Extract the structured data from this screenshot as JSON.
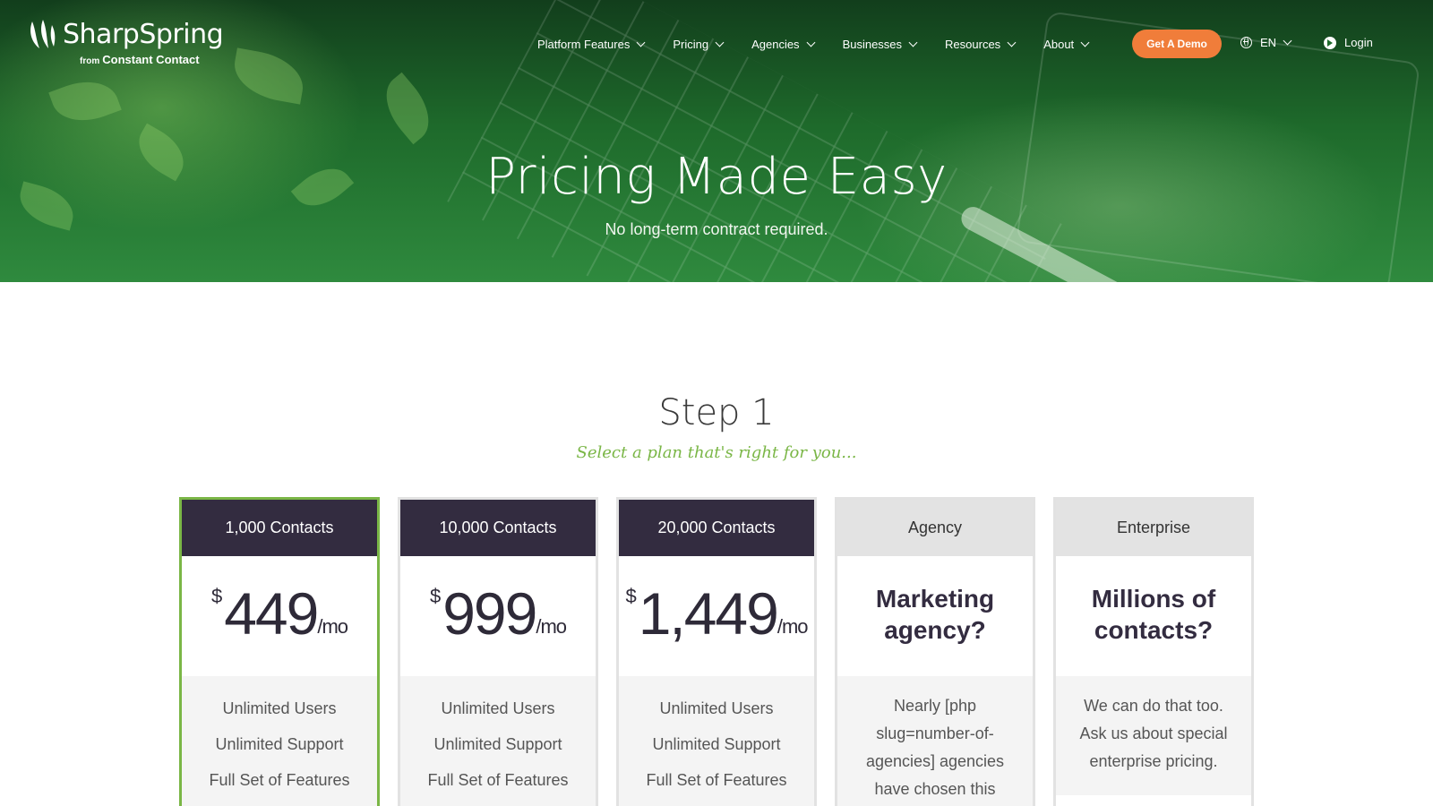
{
  "brand": {
    "name": "SharpSpring",
    "sub_from": "from",
    "sub_company": "Constant Contact"
  },
  "nav": {
    "items": [
      {
        "label": "Platform Features"
      },
      {
        "label": "Pricing"
      },
      {
        "label": "Agencies"
      },
      {
        "label": "Businesses"
      },
      {
        "label": "Resources"
      },
      {
        "label": "About"
      }
    ],
    "demo_label": "Get A Demo",
    "lang_label": "EN",
    "login_label": "Login"
  },
  "hero": {
    "title": "Pricing Made Easy",
    "subtitle": "No long-term contract required."
  },
  "step": {
    "title": "Step 1",
    "subtitle": "Select a plan that's right for you..."
  },
  "plans": [
    {
      "name": "1,000 Contacts",
      "currency": "$",
      "amount": "449",
      "period": "/mo",
      "features": [
        "Unlimited Users",
        "Unlimited Support",
        "Full Set of Features"
      ]
    },
    {
      "name": "10,000 Contacts",
      "currency": "$",
      "amount": "999",
      "period": "/mo",
      "features": [
        "Unlimited Users",
        "Unlimited Support",
        "Full Set of Features"
      ]
    },
    {
      "name": "20,000 Contacts",
      "currency": "$",
      "amount": "1,449",
      "period": "/mo",
      "features": [
        "Unlimited Users",
        "Unlimited Support",
        "Full Set of Features"
      ]
    },
    {
      "name": "Agency",
      "question": "Marketing agency?",
      "text": "Nearly [php slug=number-of-agencies] agencies have chosen this"
    },
    {
      "name": "Enterprise",
      "question": "Millions of contacts?",
      "text": "We can do that too. Ask us about special enterprise pricing."
    }
  ],
  "colors": {
    "accent_green": "#7ab646",
    "demo_orange": "#f07d3a",
    "plan_header_dark": "#332c40",
    "hero_green": "#1e6a2b"
  },
  "icons": [
    "sharpspring-logo-icon",
    "chevron-down-icon",
    "globe-icon",
    "login-arrow-icon"
  ]
}
